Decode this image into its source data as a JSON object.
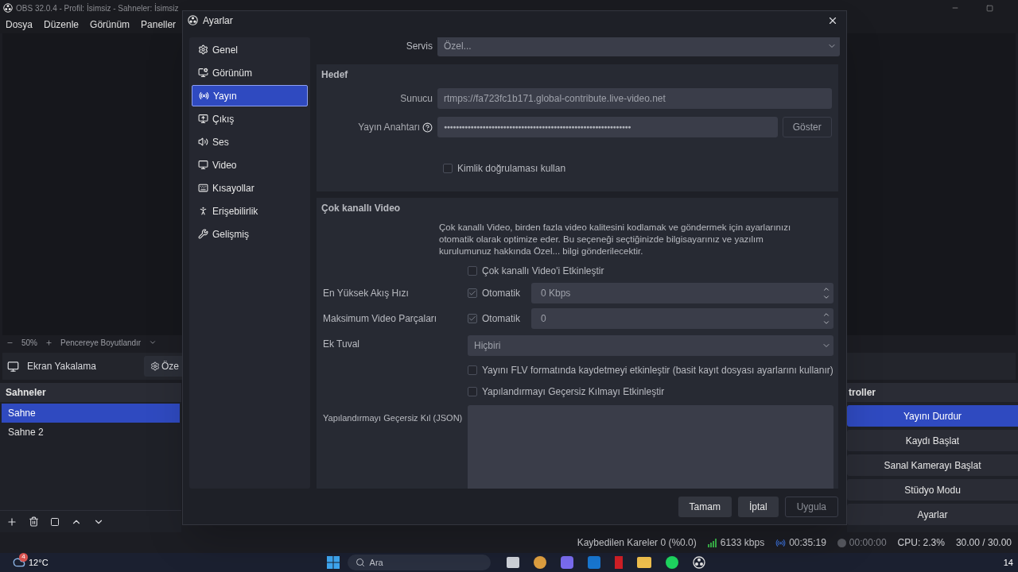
{
  "main_window": {
    "title": "OBS 32.0.4 - Profil: İsimsiz - Sahneler: İsimsiz",
    "menu": [
      "Dosya",
      "Düzenle",
      "Görünüm",
      "Paneller"
    ]
  },
  "zoom_bar": {
    "zoom": "50%",
    "fit": "Pencereye Boyutlandır"
  },
  "source_bar": {
    "source": "Ekran Yakalama",
    "properties": "Öze"
  },
  "scenes": {
    "title": "Sahneler",
    "items": [
      {
        "label": "Sahne",
        "selected": true
      },
      {
        "label": "Sahne 2",
        "selected": false
      }
    ]
  },
  "controls": {
    "title": "troller",
    "buttons": [
      {
        "label": "Yayını Durdur",
        "active": true
      },
      {
        "label": "Kaydı Başlat",
        "active": false
      },
      {
        "label": "Sanal Kamerayı Başlat",
        "active": false
      },
      {
        "label": "Stüdyo Modu",
        "active": false
      },
      {
        "label": "Ayarlar",
        "active": false
      }
    ]
  },
  "status_bar": {
    "dropped": "Kaybedilen Kareler 0 (%0.0)",
    "bitrate": "6133 kbps",
    "stream_time": "00:35:19",
    "record_time": "00:00:00",
    "cpu": "CPU: 2.3%",
    "fps": "30.00 / 30.00"
  },
  "taskbar": {
    "weather_temp": "12°C",
    "weather_badge": "4",
    "search_placeholder": "Ara",
    "clock": "14"
  },
  "dialog": {
    "title": "Ayarlar",
    "nav": [
      {
        "label": "Genel",
        "selected": false
      },
      {
        "label": "Görünüm",
        "selected": false
      },
      {
        "label": "Yayın",
        "selected": true
      },
      {
        "label": "Çıkış",
        "selected": false
      },
      {
        "label": "Ses",
        "selected": false
      },
      {
        "label": "Video",
        "selected": false
      },
      {
        "label": "Kısayollar",
        "selected": false
      },
      {
        "label": "Erişebilirlik",
        "selected": false
      },
      {
        "label": "Gelişmiş",
        "selected": false
      }
    ],
    "service": {
      "label": "Servis",
      "value": "Özel..."
    },
    "destination": {
      "title": "Hedef",
      "server_label": "Sunucu",
      "server": "rtmps://fa723fc1b171.global-contribute.live-video.net",
      "key_label": "Yayın Anahtarı",
      "key": "●●●●●●●●●●●●●●●●●●●●●●●●●●●●●●●●●●●●●●●●●●●●●●●●●●●●●●●●●●●●●●●",
      "show_button": "Göster",
      "auth": {
        "label": "Kimlik doğrulaması kullan",
        "checked": false
      }
    },
    "multitrack": {
      "title": "Çok kanallı Video",
      "description": "Çok kanallı Video, birden fazla video kalitesini kodlamak ve göndermek için ayarlarınızı otomatik olarak optimize eder. Bu seçeneği seçtiğinizde bilgisayarınız ve yazılım kurulumunuz hakkında Özel... bilgi gönderilecektir.",
      "enable": {
        "label": "Çok kanallı Video'i Etkinleştir",
        "checked": false
      },
      "max_bitrate": {
        "label": "En Yüksek Akış Hızı",
        "auto_label": "Otomatik",
        "auto": true,
        "value": "0 Kbps"
      },
      "max_tracks": {
        "label": "Maksimum Video Parçaları",
        "auto_label": "Otomatik",
        "auto": true,
        "value": "0"
      },
      "canvas": {
        "label": "Ek Tuval",
        "value": "Hiçbiri"
      },
      "flv": {
        "label": "Yayını FLV formatında kaydetmeyi etkinleştir (basit kayıt dosyası ayarlarını kullanır)",
        "checked": false
      },
      "override": {
        "label": "Yapılandırmayı Geçersiz Kılmayı Etkinleştir",
        "checked": false
      },
      "json_label": "Yapılandırmayı Geçersiz Kıl (JSON)"
    },
    "buttons": [
      "Tamam",
      "İptal",
      "Uygula"
    ]
  }
}
